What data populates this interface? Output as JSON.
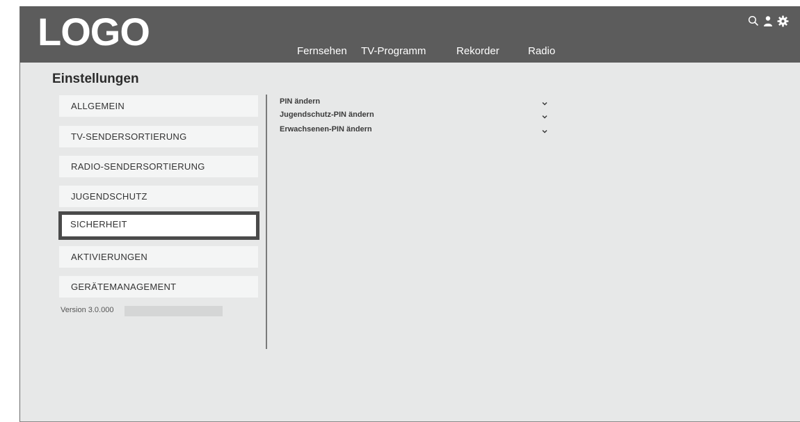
{
  "header": {
    "logo": "LOGO",
    "nav": [
      "Fernsehen",
      "TV-Programm",
      "Rekorder",
      "Radio"
    ],
    "icons": [
      "search-icon",
      "user-icon",
      "gear-icon"
    ]
  },
  "page": {
    "title": "Einstellungen"
  },
  "sidebar": {
    "items": [
      {
        "label": "ALLGEMEIN",
        "active": false
      },
      {
        "label": "TV-SENDERSORTIERUNG",
        "active": false
      },
      {
        "label": "RADIO-SENDERSORTIERUNG",
        "active": false
      },
      {
        "label": "JUGENDSCHUTZ",
        "active": false
      },
      {
        "label": "SICHERHEIT",
        "active": true
      },
      {
        "label": "AKTIVIERUNGEN",
        "active": false
      },
      {
        "label": "GERÄTEMANAGEMENT",
        "active": false
      }
    ],
    "version": "Version 3.0.000"
  },
  "security": {
    "rows": [
      {
        "label": "PIN ändern"
      },
      {
        "label": "Jugendschutz-PIN ändern"
      },
      {
        "label": "Erwachsenen-PIN ändern"
      }
    ]
  },
  "colors": {
    "header": "#5c5c5c",
    "background": "#e7e8e8",
    "active_border": "#4a4a4a"
  }
}
